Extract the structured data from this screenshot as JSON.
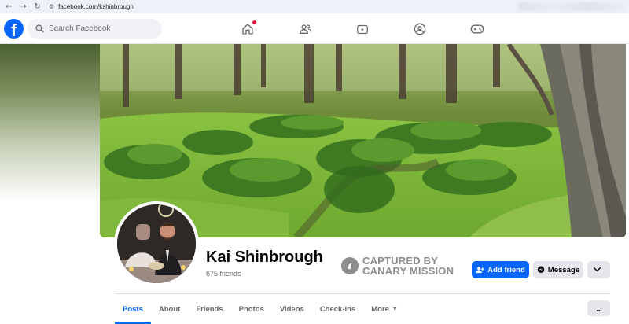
{
  "browser": {
    "back_icon": "←",
    "forward_icon": "→",
    "reload_icon": "↻",
    "site_icon": "⚙",
    "url": "facebook.com/kshinbrough"
  },
  "header": {
    "logo": "f",
    "search_placeholder": "Search Facebook",
    "nav_icons": [
      "home-icon",
      "friends-icon",
      "watch-icon",
      "groups-icon",
      "gaming-icon"
    ]
  },
  "profile": {
    "name": "Kai Shinbrough",
    "friends": "675 friends",
    "stamp_line1": "CAPTURED BY",
    "stamp_line2": "CANARY MISSION",
    "add_friend_label": "Add friend",
    "message_label": "Message"
  },
  "tabs": {
    "items": [
      "Posts",
      "About",
      "Friends",
      "Photos",
      "Videos",
      "Check-ins"
    ],
    "more_label": "More",
    "caret": "▼",
    "overflow_label": "..."
  },
  "colors": {
    "brand": "#0866ff",
    "secondary_button": "#e4e6eb",
    "stamp": "#8d8d8d"
  }
}
